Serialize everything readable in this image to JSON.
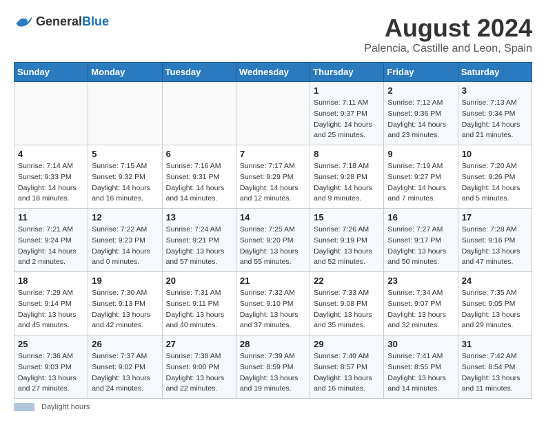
{
  "header": {
    "logo_general": "General",
    "logo_blue": "Blue",
    "title": "August 2024",
    "subtitle": "Palencia, Castille and Leon, Spain"
  },
  "days_of_week": [
    "Sunday",
    "Monday",
    "Tuesday",
    "Wednesday",
    "Thursday",
    "Friday",
    "Saturday"
  ],
  "weeks": [
    [
      {
        "day": "",
        "info": ""
      },
      {
        "day": "",
        "info": ""
      },
      {
        "day": "",
        "info": ""
      },
      {
        "day": "",
        "info": ""
      },
      {
        "day": "1",
        "info": "Sunrise: 7:11 AM\nSunset: 9:37 PM\nDaylight: 14 hours and 25 minutes."
      },
      {
        "day": "2",
        "info": "Sunrise: 7:12 AM\nSunset: 9:36 PM\nDaylight: 14 hours and 23 minutes."
      },
      {
        "day": "3",
        "info": "Sunrise: 7:13 AM\nSunset: 9:34 PM\nDaylight: 14 hours and 21 minutes."
      }
    ],
    [
      {
        "day": "4",
        "info": "Sunrise: 7:14 AM\nSunset: 9:33 PM\nDaylight: 14 hours and 18 minutes."
      },
      {
        "day": "5",
        "info": "Sunrise: 7:15 AM\nSunset: 9:32 PM\nDaylight: 14 hours and 16 minutes."
      },
      {
        "day": "6",
        "info": "Sunrise: 7:16 AM\nSunset: 9:31 PM\nDaylight: 14 hours and 14 minutes."
      },
      {
        "day": "7",
        "info": "Sunrise: 7:17 AM\nSunset: 9:29 PM\nDaylight: 14 hours and 12 minutes."
      },
      {
        "day": "8",
        "info": "Sunrise: 7:18 AM\nSunset: 9:28 PM\nDaylight: 14 hours and 9 minutes."
      },
      {
        "day": "9",
        "info": "Sunrise: 7:19 AM\nSunset: 9:27 PM\nDaylight: 14 hours and 7 minutes."
      },
      {
        "day": "10",
        "info": "Sunrise: 7:20 AM\nSunset: 9:26 PM\nDaylight: 14 hours and 5 minutes."
      }
    ],
    [
      {
        "day": "11",
        "info": "Sunrise: 7:21 AM\nSunset: 9:24 PM\nDaylight: 14 hours and 2 minutes."
      },
      {
        "day": "12",
        "info": "Sunrise: 7:22 AM\nSunset: 9:23 PM\nDaylight: 14 hours and 0 minutes."
      },
      {
        "day": "13",
        "info": "Sunrise: 7:24 AM\nSunset: 9:21 PM\nDaylight: 13 hours and 57 minutes."
      },
      {
        "day": "14",
        "info": "Sunrise: 7:25 AM\nSunset: 9:20 PM\nDaylight: 13 hours and 55 minutes."
      },
      {
        "day": "15",
        "info": "Sunrise: 7:26 AM\nSunset: 9:19 PM\nDaylight: 13 hours and 52 minutes."
      },
      {
        "day": "16",
        "info": "Sunrise: 7:27 AM\nSunset: 9:17 PM\nDaylight: 13 hours and 50 minutes."
      },
      {
        "day": "17",
        "info": "Sunrise: 7:28 AM\nSunset: 9:16 PM\nDaylight: 13 hours and 47 minutes."
      }
    ],
    [
      {
        "day": "18",
        "info": "Sunrise: 7:29 AM\nSunset: 9:14 PM\nDaylight: 13 hours and 45 minutes."
      },
      {
        "day": "19",
        "info": "Sunrise: 7:30 AM\nSunset: 9:13 PM\nDaylight: 13 hours and 42 minutes."
      },
      {
        "day": "20",
        "info": "Sunrise: 7:31 AM\nSunset: 9:11 PM\nDaylight: 13 hours and 40 minutes."
      },
      {
        "day": "21",
        "info": "Sunrise: 7:32 AM\nSunset: 9:10 PM\nDaylight: 13 hours and 37 minutes."
      },
      {
        "day": "22",
        "info": "Sunrise: 7:33 AM\nSunset: 9:08 PM\nDaylight: 13 hours and 35 minutes."
      },
      {
        "day": "23",
        "info": "Sunrise: 7:34 AM\nSunset: 9:07 PM\nDaylight: 13 hours and 32 minutes."
      },
      {
        "day": "24",
        "info": "Sunrise: 7:35 AM\nSunset: 9:05 PM\nDaylight: 13 hours and 29 minutes."
      }
    ],
    [
      {
        "day": "25",
        "info": "Sunrise: 7:36 AM\nSunset: 9:03 PM\nDaylight: 13 hours and 27 minutes."
      },
      {
        "day": "26",
        "info": "Sunrise: 7:37 AM\nSunset: 9:02 PM\nDaylight: 13 hours and 24 minutes."
      },
      {
        "day": "27",
        "info": "Sunrise: 7:38 AM\nSunset: 9:00 PM\nDaylight: 13 hours and 22 minutes."
      },
      {
        "day": "28",
        "info": "Sunrise: 7:39 AM\nSunset: 8:59 PM\nDaylight: 13 hours and 19 minutes."
      },
      {
        "day": "29",
        "info": "Sunrise: 7:40 AM\nSunset: 8:57 PM\nDaylight: 13 hours and 16 minutes."
      },
      {
        "day": "30",
        "info": "Sunrise: 7:41 AM\nSunset: 8:55 PM\nDaylight: 13 hours and 14 minutes."
      },
      {
        "day": "31",
        "info": "Sunrise: 7:42 AM\nSunset: 8:54 PM\nDaylight: 13 hours and 11 minutes."
      }
    ]
  ],
  "footer": {
    "daylight_label": "Daylight hours"
  }
}
